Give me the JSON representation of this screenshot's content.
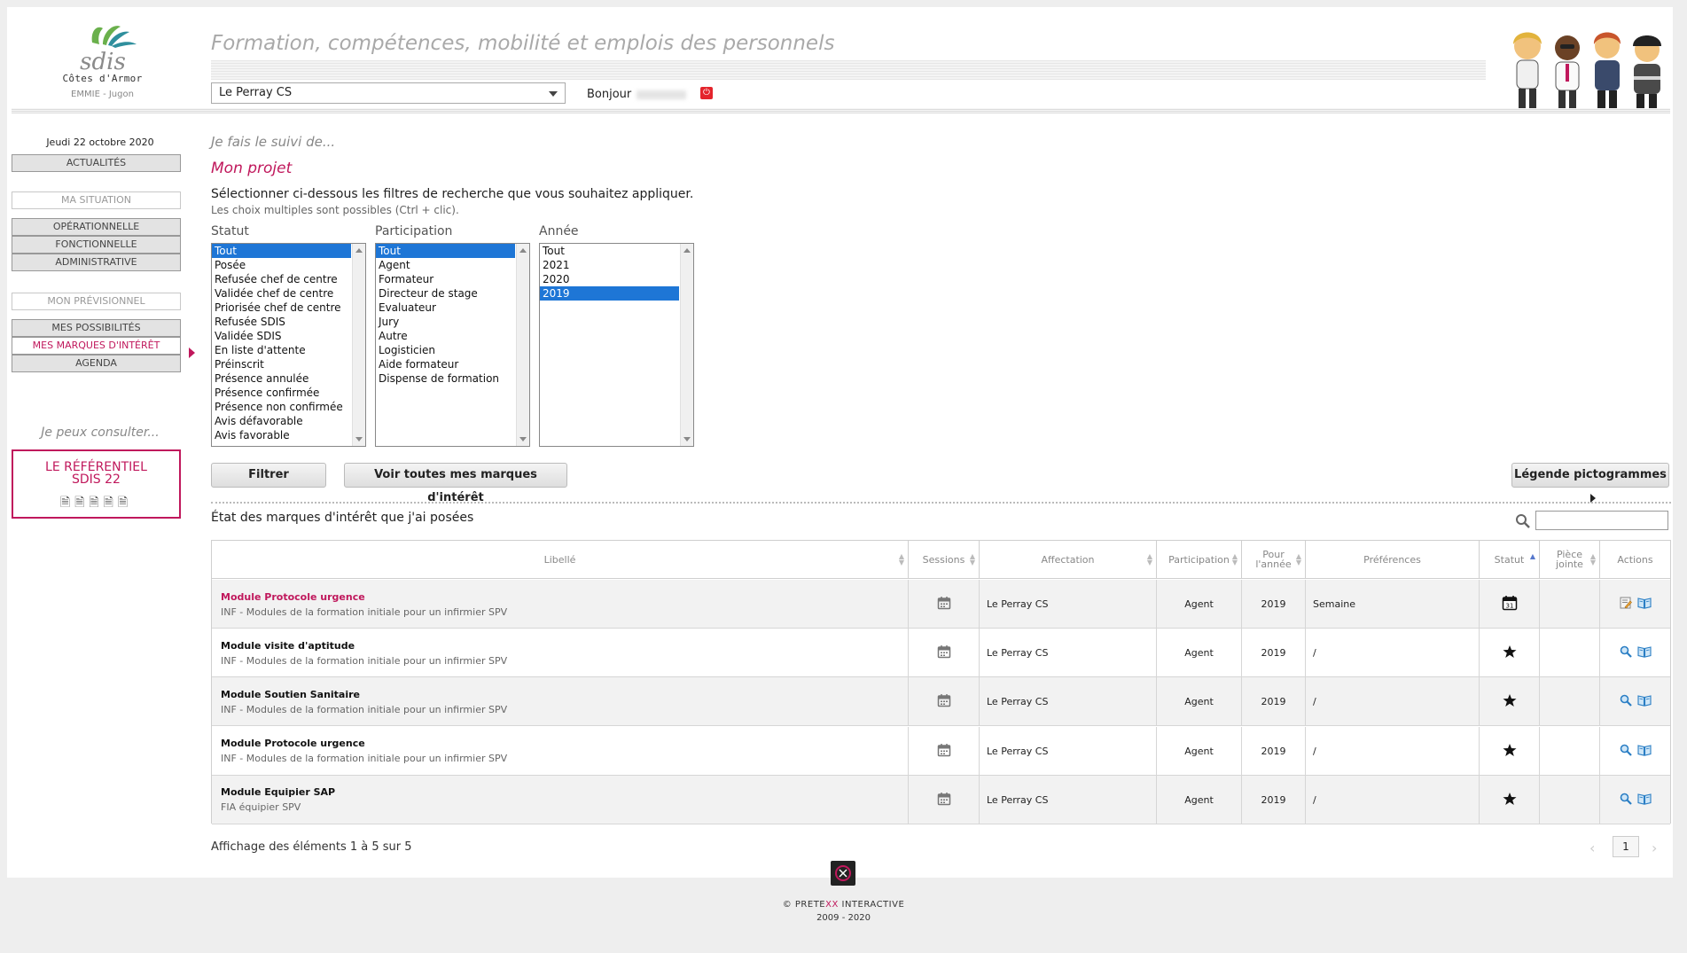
{
  "header": {
    "logo_text": "sdis",
    "department": "Côtes d'Armor",
    "site": "EMMIE - Jugon",
    "tagline": "Formation, compétences, mobilité et emplois des personnels",
    "selected_site": "Le Perray CS",
    "greeting": "Bonjour"
  },
  "sidebar": {
    "date": "Jeudi 22 octobre 2020",
    "news": "ACTUALITÉS",
    "situation_heading": "MA SITUATION",
    "situation_items": [
      "OPÉRATIONNELLE",
      "FONCTIONNELLE",
      "ADMINISTRATIVE"
    ],
    "forecast_heading": "MON PRÉVISIONNEL",
    "forecast_items": [
      "MES POSSIBILITÉS",
      "MES MARQUES D'INTÉRÊT",
      "AGENDA"
    ],
    "active_item": "MES MARQUES D'INTÉRÊT",
    "consult_label": "Je peux consulter...",
    "referential_line1": "LE RÉFÉRENTIEL",
    "referential_line2": "SDIS 22"
  },
  "main": {
    "breadcrumb": "Je fais le suivi de...",
    "title": "Mon projet",
    "intro": "Sélectionner ci-dessous les filtres de recherche que vous souhaitez appliquer.",
    "hint": "Les choix multiples sont possibles (Ctrl + clic).",
    "filters": {
      "statut": {
        "label": "Statut",
        "options": [
          "Tout",
          "Posée",
          "Refusée chef de centre",
          "Validée chef de centre",
          "Priorisée chef de centre",
          "Refusée SDIS",
          "Validée SDIS",
          "En liste d'attente",
          "Préinscrit",
          "Présence annulée",
          "Présence confirmée",
          "Présence non confirmée",
          "Avis défavorable",
          "Avis favorable"
        ],
        "selected": "Tout"
      },
      "participation": {
        "label": "Participation",
        "options": [
          "Tout",
          "Agent",
          "Formateur",
          "Directeur de stage",
          "Evaluateur",
          "Jury",
          "Autre",
          "Logisticien",
          "Aide formateur",
          "Dispense de formation"
        ],
        "selected": "Tout"
      },
      "annee": {
        "label": "Année",
        "options": [
          "Tout",
          "2021",
          "2020",
          "2019"
        ],
        "selected": "2019"
      }
    },
    "filter_button": "Filtrer",
    "all_button": "Voir toutes mes marques d'intérêt",
    "legend_button": "Légende pictogrammes",
    "table_title": "État des marques d'intérêt que j'ai posées",
    "columns": {
      "libelle": "Libellé",
      "sessions": "Sessions",
      "affectation": "Affectation",
      "participation": "Participation",
      "annee_line1": "Pour",
      "annee_line2": "l'année",
      "preferences": "Préférences",
      "statut": "Statut",
      "piece_line1": "Pièce",
      "piece_line2": "jointe",
      "actions": "Actions"
    },
    "rows": [
      {
        "title": "Module Protocole urgence",
        "subtitle": "INF - Modules de la formation initiale pour un infirmier SPV",
        "affectation": "Le Perray CS",
        "participation": "Agent",
        "annee": "2019",
        "preferences": "Semaine",
        "statut_icon": "calendar-status-icon",
        "highlight": true
      },
      {
        "title": "Module visite d'aptitude",
        "subtitle": "INF - Modules de la formation initiale pour un infirmier SPV",
        "affectation": "Le Perray CS",
        "participation": "Agent",
        "annee": "2019",
        "preferences": "/",
        "statut_icon": "star-icon",
        "highlight": false
      },
      {
        "title": "Module Soutien Sanitaire",
        "subtitle": "INF - Modules de la formation initiale pour un infirmier SPV",
        "affectation": "Le Perray CS",
        "participation": "Agent",
        "annee": "2019",
        "preferences": "/",
        "statut_icon": "star-icon",
        "highlight": false
      },
      {
        "title": "Module Protocole urgence",
        "subtitle": "INF - Modules de la formation initiale pour un infirmier SPV",
        "affectation": "Le Perray CS",
        "participation": "Agent",
        "annee": "2019",
        "preferences": "/",
        "statut_icon": "star-icon",
        "highlight": false
      },
      {
        "title": "Module Equipier SAP",
        "subtitle": "FIA équipier SPV",
        "affectation": "Le Perray CS",
        "participation": "Agent",
        "annee": "2019",
        "preferences": "/",
        "statut_icon": "star-icon",
        "highlight": false
      }
    ],
    "pagination_info": "Affichage des éléments 1 à 5 sur 5",
    "current_page": "1",
    "prev": "‹",
    "next": "›"
  },
  "footer": {
    "copyright_prefix": "© PRETE",
    "copyright_accent": "XX",
    "copyright_suffix": " INTERACTIVE",
    "years": "2009 - 2020"
  },
  "colors": {
    "accent": "#c0185c",
    "selection": "#1e76d6",
    "logo_green": "#6ab04c",
    "logo_teal": "#2f8f9d"
  }
}
